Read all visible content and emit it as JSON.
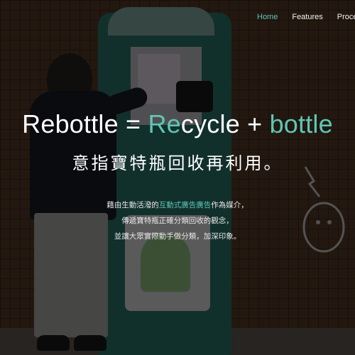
{
  "nav": {
    "items": [
      {
        "label": "Home",
        "active": true
      },
      {
        "label": "Features",
        "active": false
      },
      {
        "label": "Proce",
        "active": false
      }
    ]
  },
  "hero": {
    "title_prefix": "Rebottle = ",
    "title_re": "Re",
    "title_cycle": "cycle + ",
    "title_bottle": "bottle",
    "subtitle": "意指寶特瓶回收再利用。"
  },
  "description": {
    "line1_before": "藉由生動活潑的",
    "line1_highlight": "互動式廣告廣告",
    "line1_after": "作為媒介，",
    "line2": "傳遞寶特瓶正確分類回收的觀念，",
    "line3": "並讓大眾實際動手做分類，加深印象。"
  },
  "colors": {
    "accent": "#5fc6b3",
    "text": "#ffffff"
  }
}
